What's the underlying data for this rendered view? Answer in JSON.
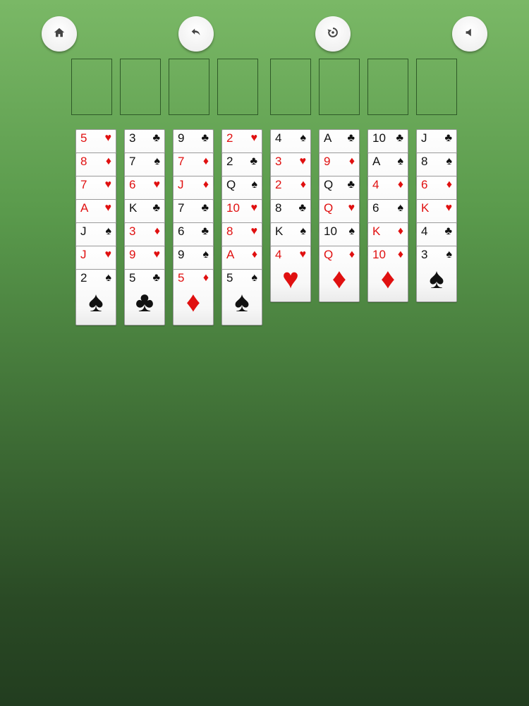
{
  "toolbar": {
    "buttons": [
      {
        "icon": "home-icon"
      },
      {
        "icon": "undo-icon"
      },
      {
        "icon": "restart-icon"
      },
      {
        "icon": "sound-icon"
      }
    ]
  },
  "freecells": [
    {},
    {},
    {},
    {},
    {},
    {},
    {},
    {}
  ],
  "tableau": [
    [
      {
        "rank": "5",
        "suit": "♥",
        "color": "red"
      },
      {
        "rank": "8",
        "suit": "♦",
        "color": "red"
      },
      {
        "rank": "7",
        "suit": "♥",
        "color": "red"
      },
      {
        "rank": "A",
        "suit": "♥",
        "color": "red"
      },
      {
        "rank": "J",
        "suit": "♠",
        "color": "black"
      },
      {
        "rank": "J",
        "suit": "♥",
        "color": "red"
      },
      {
        "rank": "2",
        "suit": "♠",
        "color": "black"
      }
    ],
    [
      {
        "rank": "3",
        "suit": "♣",
        "color": "black"
      },
      {
        "rank": "7",
        "suit": "♠",
        "color": "black"
      },
      {
        "rank": "6",
        "suit": "♥",
        "color": "red"
      },
      {
        "rank": "K",
        "suit": "♣",
        "color": "black"
      },
      {
        "rank": "3",
        "suit": "♦",
        "color": "red"
      },
      {
        "rank": "9",
        "suit": "♥",
        "color": "red"
      },
      {
        "rank": "5",
        "suit": "♣",
        "color": "black"
      }
    ],
    [
      {
        "rank": "9",
        "suit": "♣",
        "color": "black"
      },
      {
        "rank": "7",
        "suit": "♦",
        "color": "red"
      },
      {
        "rank": "J",
        "suit": "♦",
        "color": "red"
      },
      {
        "rank": "7",
        "suit": "♣",
        "color": "black"
      },
      {
        "rank": "6",
        "suit": "♣",
        "color": "black"
      },
      {
        "rank": "9",
        "suit": "♠",
        "color": "black"
      },
      {
        "rank": "5",
        "suit": "♦",
        "color": "red"
      }
    ],
    [
      {
        "rank": "2",
        "suit": "♥",
        "color": "red"
      },
      {
        "rank": "2",
        "suit": "♣",
        "color": "black"
      },
      {
        "rank": "Q",
        "suit": "♠",
        "color": "black"
      },
      {
        "rank": "10",
        "suit": "♥",
        "color": "red"
      },
      {
        "rank": "8",
        "suit": "♥",
        "color": "red"
      },
      {
        "rank": "A",
        "suit": "♦",
        "color": "red"
      },
      {
        "rank": "5",
        "suit": "♠",
        "color": "black"
      }
    ],
    [
      {
        "rank": "4",
        "suit": "♠",
        "color": "black"
      },
      {
        "rank": "3",
        "suit": "♥",
        "color": "red"
      },
      {
        "rank": "2",
        "suit": "♦",
        "color": "red"
      },
      {
        "rank": "8",
        "suit": "♣",
        "color": "black"
      },
      {
        "rank": "K",
        "suit": "♠",
        "color": "black"
      },
      {
        "rank": "4",
        "suit": "♥",
        "color": "red"
      }
    ],
    [
      {
        "rank": "A",
        "suit": "♣",
        "color": "black"
      },
      {
        "rank": "9",
        "suit": "♦",
        "color": "red"
      },
      {
        "rank": "Q",
        "suit": "♣",
        "color": "black"
      },
      {
        "rank": "Q",
        "suit": "♥",
        "color": "red"
      },
      {
        "rank": "10",
        "suit": "♠",
        "color": "black"
      },
      {
        "rank": "Q",
        "suit": "♦",
        "color": "red"
      }
    ],
    [
      {
        "rank": "10",
        "suit": "♣",
        "color": "black"
      },
      {
        "rank": "A",
        "suit": "♠",
        "color": "black"
      },
      {
        "rank": "4",
        "suit": "♦",
        "color": "red"
      },
      {
        "rank": "6",
        "suit": "♠",
        "color": "black"
      },
      {
        "rank": "K",
        "suit": "♦",
        "color": "red"
      },
      {
        "rank": "10",
        "suit": "♦",
        "color": "red"
      }
    ],
    [
      {
        "rank": "J",
        "suit": "♣",
        "color": "black"
      },
      {
        "rank": "8",
        "suit": "♠",
        "color": "black"
      },
      {
        "rank": "6",
        "suit": "♦",
        "color": "red"
      },
      {
        "rank": "K",
        "suit": "♥",
        "color": "red"
      },
      {
        "rank": "4",
        "suit": "♣",
        "color": "black"
      },
      {
        "rank": "3",
        "suit": "♠",
        "color": "black"
      }
    ]
  ]
}
